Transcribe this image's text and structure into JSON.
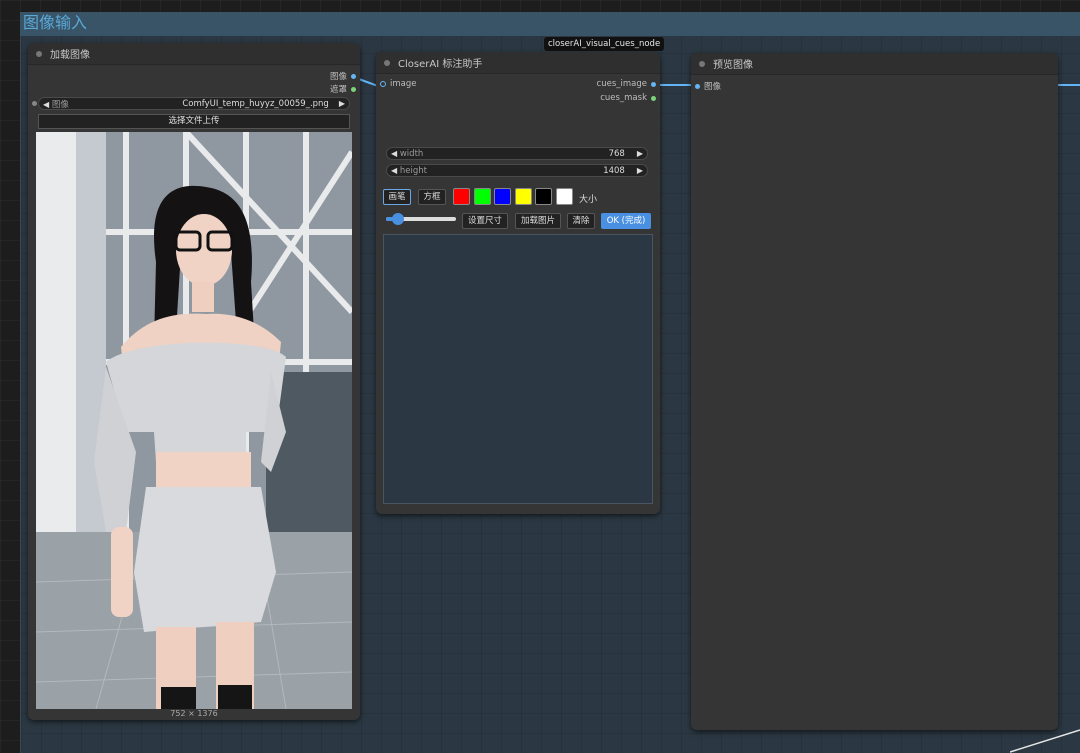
{
  "group": {
    "title": "图像输入"
  },
  "badge": {
    "label": "closerAI_visual_cues_node"
  },
  "load_node": {
    "title": "加载图像",
    "outputs": [
      "图像",
      "遮罩"
    ],
    "image_widget": {
      "label": "图像",
      "value": "ComfyUI_temp_huyyz_00059_.png"
    },
    "upload_label": "选择文件上传",
    "dimensions": "752 × 1376"
  },
  "closer_node": {
    "title": "CloserAI 标注助手",
    "input": "image",
    "outputs": [
      "cues_image",
      "cues_mask"
    ],
    "width": {
      "label": "width",
      "value": "768"
    },
    "height": {
      "label": "height",
      "value": "1408"
    },
    "tools": {
      "brush": "画笔",
      "box": "方框",
      "size_label": "大小"
    },
    "colors": [
      "#ff0000",
      "#00ff00",
      "#0000ff",
      "#ffff00",
      "#000000",
      "#ffffff"
    ],
    "actions": {
      "set_size": "设置尺寸",
      "load_image": "加载图片",
      "clear": "清除",
      "ok": "OK (完成)"
    },
    "slider_value": 0.15
  },
  "preview_node": {
    "title": "预览图像",
    "input": "图像"
  },
  "icons": {
    "left_arrow": "◀",
    "right_arrow": "▶"
  }
}
